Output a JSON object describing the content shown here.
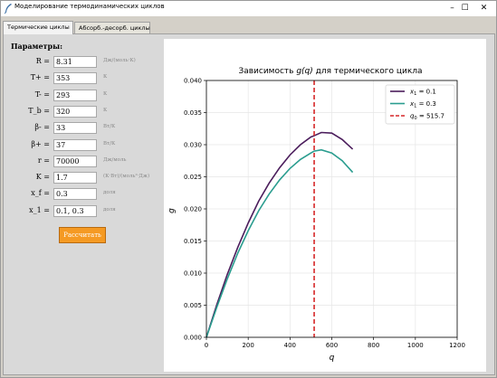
{
  "window": {
    "title": "Моделирование термодинамических циклов",
    "minimize_glyph": "–",
    "maximize_glyph": "☐",
    "close_glyph": "✕"
  },
  "tabs": [
    {
      "label": "Термические циклы",
      "active": true
    },
    {
      "label": "Абсорб.-десорб. циклы",
      "active": false
    }
  ],
  "params": {
    "title": "Параметры:",
    "rows": [
      {
        "label": "R =",
        "value": "8.31",
        "unit": "Дж/(моль·К)"
      },
      {
        "label": "T+ =",
        "value": "353",
        "unit": "К"
      },
      {
        "label": "T- =",
        "value": "293",
        "unit": "К"
      },
      {
        "label": "T_b =",
        "value": "320",
        "unit": "К"
      },
      {
        "label": "β- =",
        "value": "33",
        "unit": "Вт/К"
      },
      {
        "label": "β+ =",
        "value": "37",
        "unit": "Вт/К"
      },
      {
        "label": "r =",
        "value": "70000",
        "unit": "Дж/моль"
      },
      {
        "label": "K =",
        "value": "1.7",
        "unit": "(К·Вт)/(моль²·Дж)"
      },
      {
        "label": "x_f =",
        "value": "0.3",
        "unit": "доля"
      },
      {
        "label": "x_1 =",
        "value": "0.1, 0.3",
        "unit": "доля"
      }
    ],
    "calculate_label": "Рассчитать"
  },
  "colors": {
    "accent_button": "#f59a23",
    "series_1": "#4b1d5c",
    "series_2": "#2a9d8f",
    "q0_line": "#d62728"
  },
  "chart_data": {
    "type": "line",
    "title_prefix": "Зависимость ",
    "title_fn": "g(q)",
    "title_suffix": " для термического цикла",
    "xlabel": "q",
    "ylabel": "g",
    "xlim": [
      0,
      1200
    ],
    "ylim": [
      0,
      0.04
    ],
    "xticks": [
      "0",
      "200",
      "400",
      "600",
      "800",
      "1000",
      "1200"
    ],
    "yticks": [
      "0.000",
      "0.005",
      "0.010",
      "0.015",
      "0.020",
      "0.025",
      "0.030",
      "0.035",
      "0.040"
    ],
    "grid": true,
    "legend_position": "top-right",
    "series": [
      {
        "name": "x₁ = 0.1",
        "name_main": "x",
        "name_sub": "1",
        "name_rest": " = 0.1",
        "x": [
          0,
          50,
          100,
          150,
          200,
          250,
          300,
          350,
          400,
          450,
          500,
          515.7,
          550,
          600,
          650,
          700
        ],
        "y": [
          0,
          0.0051,
          0.0098,
          0.014,
          0.0178,
          0.0212,
          0.024,
          0.0264,
          0.0284,
          0.03,
          0.0312,
          0.0314,
          0.0319,
          0.0318,
          0.0308,
          0.0293
        ]
      },
      {
        "name": "x₁ = 0.3",
        "name_main": "x",
        "name_sub": "1",
        "name_rest": " = 0.3",
        "x": [
          0,
          50,
          100,
          150,
          200,
          250,
          300,
          350,
          400,
          450,
          500,
          515.7,
          550,
          600,
          650,
          700
        ],
        "y": [
          0,
          0.0047,
          0.0091,
          0.0131,
          0.0166,
          0.0197,
          0.0223,
          0.0245,
          0.0263,
          0.0277,
          0.0287,
          0.029,
          0.0292,
          0.0287,
          0.0275,
          0.0257
        ]
      }
    ],
    "vline": {
      "name": "q₀ = 515.7",
      "name_main": "q",
      "name_sub": "0",
      "name_rest": " = 515.7",
      "x": 515.7
    }
  }
}
